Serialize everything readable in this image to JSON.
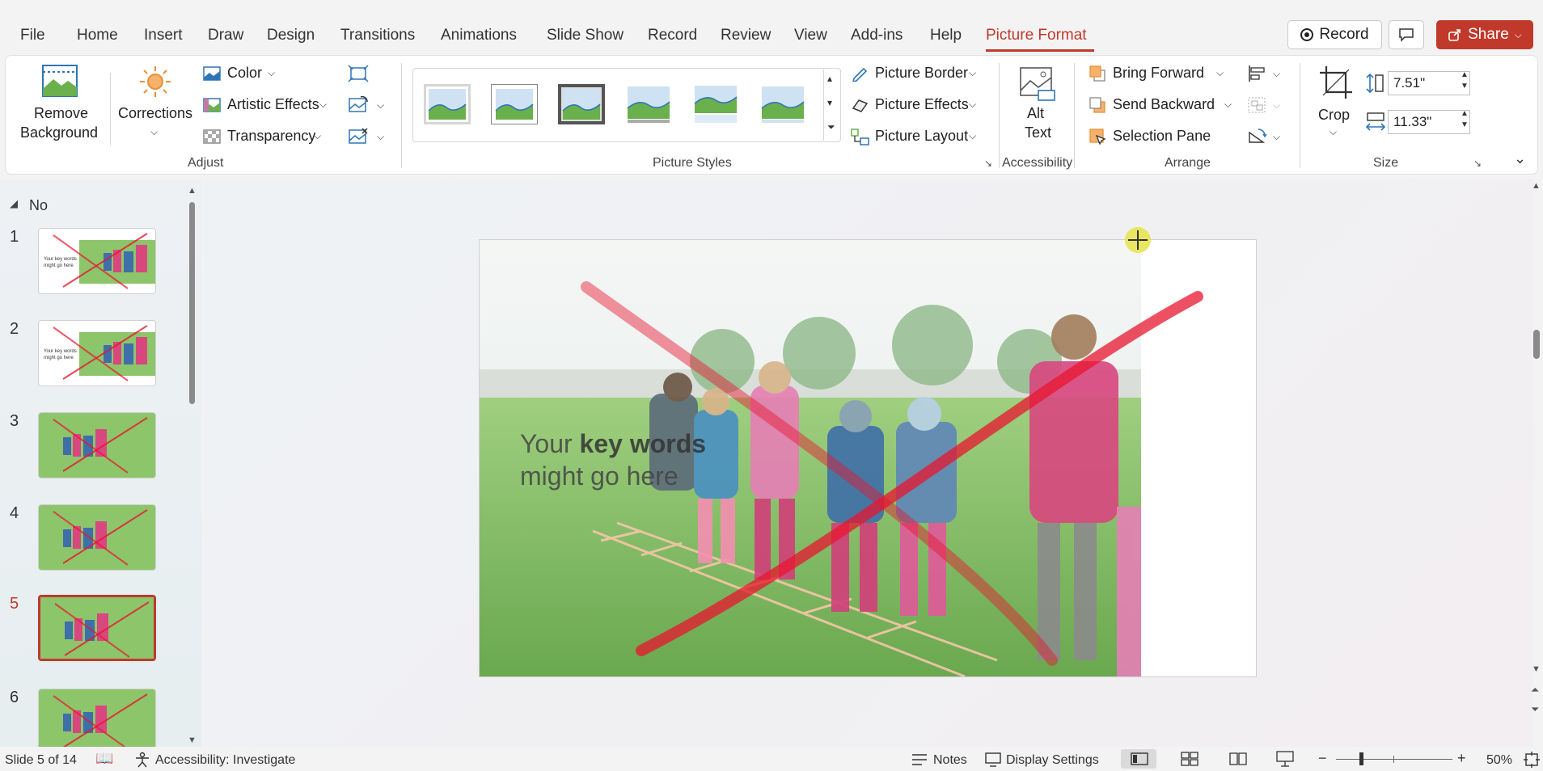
{
  "tabs": [
    "File",
    "Home",
    "Insert",
    "Draw",
    "Design",
    "Transitions",
    "Animations",
    "Slide Show",
    "Record",
    "Review",
    "View",
    "Add-ins",
    "Help",
    "Picture Format"
  ],
  "active_tab": "Picture Format",
  "top_buttons": {
    "record": "Record",
    "share": "Share"
  },
  "ribbon": {
    "remove_background": [
      "Remove",
      "Background"
    ],
    "corrections": "Corrections",
    "color": "Color",
    "artistic_effects": "Artistic Effects",
    "transparency": "Transparency",
    "picture_border": "Picture Border",
    "picture_effects": "Picture Effects",
    "picture_layout": "Picture Layout",
    "alt_text": [
      "Alt",
      "Text"
    ],
    "bring_forward": "Bring Forward",
    "send_backward": "Send Backward",
    "selection_pane": "Selection Pane",
    "crop": "Crop",
    "height": "7.51\"",
    "width": "11.33\"",
    "groups": {
      "adjust": "Adjust",
      "picture_styles": "Picture Styles",
      "accessibility": "Accessibility",
      "arrange": "Arrange",
      "size": "Size"
    }
  },
  "slide_panel": {
    "section": "No",
    "slides": [
      "1",
      "2",
      "3",
      "4",
      "5",
      "6"
    ],
    "selected": "5",
    "thumb_text": [
      "Your key words",
      "might go here"
    ]
  },
  "slide": {
    "text_line1_normal": "Your ",
    "text_line1_bold": "key words",
    "text_line2": "might go here"
  },
  "status": {
    "slide_count": "Slide 5 of 14",
    "accessibility": "Accessibility: Investigate",
    "notes": "Notes",
    "display_settings": "Display Settings",
    "zoom": "50%"
  },
  "colors": {
    "accent": "#c0392b",
    "share_bg": "#c0392b",
    "annotation_red": "#e8152f",
    "grass": "#6aa84f"
  }
}
